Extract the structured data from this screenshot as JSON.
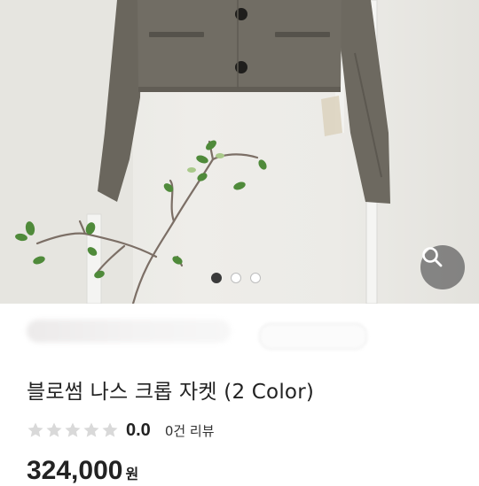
{
  "product": {
    "title": "블로썸 나스 크롭 자켓 (2 Color)",
    "rating": {
      "score": "0.0",
      "review_count_label": "0건 리뷰",
      "stars_total": 5,
      "stars_filled": 0
    },
    "price": {
      "amount": "324,000",
      "currency_unit": "원"
    }
  },
  "gallery": {
    "image_count": 3,
    "active_index": 0,
    "zoom_icon": "magnifier-icon"
  },
  "colors": {
    "star_empty": "#d9d9d9",
    "dot_active": "#3a3a3a",
    "zoom_button_bg": "#6e6e6e"
  }
}
